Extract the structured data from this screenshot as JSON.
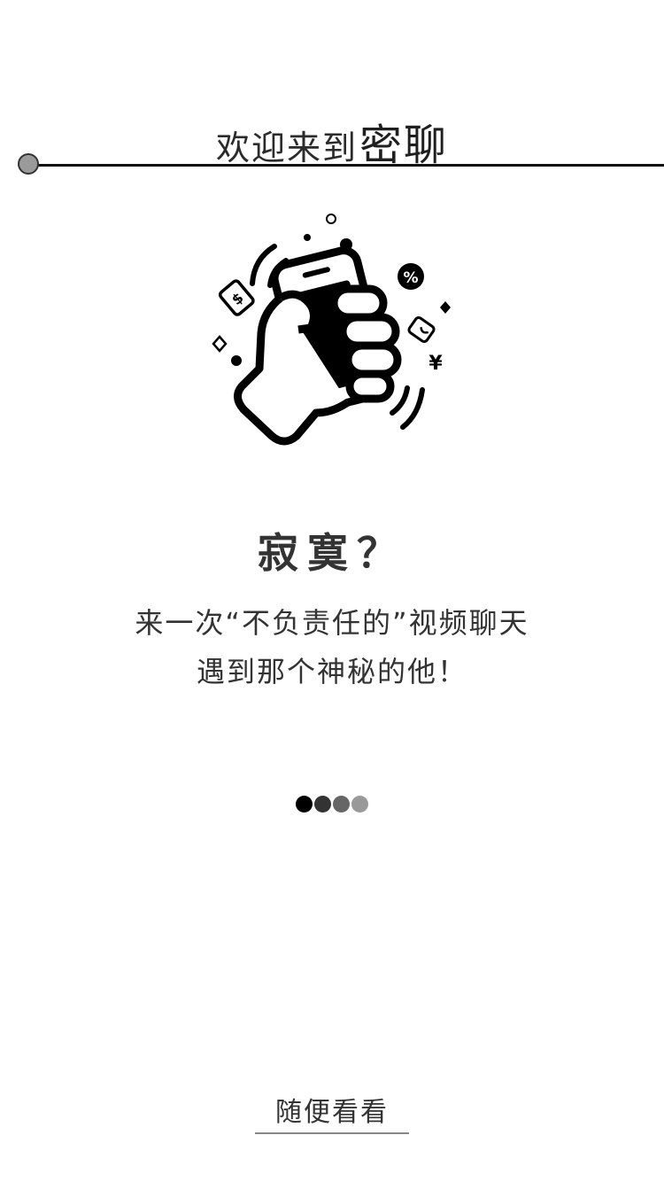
{
  "header": {
    "welcome_text": "欢迎来到",
    "brand_name": "密聊"
  },
  "hero": {
    "icon": "hand-holding-phone-illustration"
  },
  "content": {
    "headline": "寂寞？",
    "line1": "来一次“不负责任的”视频聊天",
    "line2": "遇到那个神秘的他！"
  },
  "pager": {
    "total": 4,
    "current": 1,
    "dot_colors": [
      "#000000",
      "#333333",
      "#666666",
      "#999999"
    ]
  },
  "actions": {
    "skip_label": "随便看看"
  },
  "colors": {
    "background": "#ffffff",
    "text": "#333333",
    "rule": "#111111",
    "rule_dot": "#9a9a9a"
  }
}
